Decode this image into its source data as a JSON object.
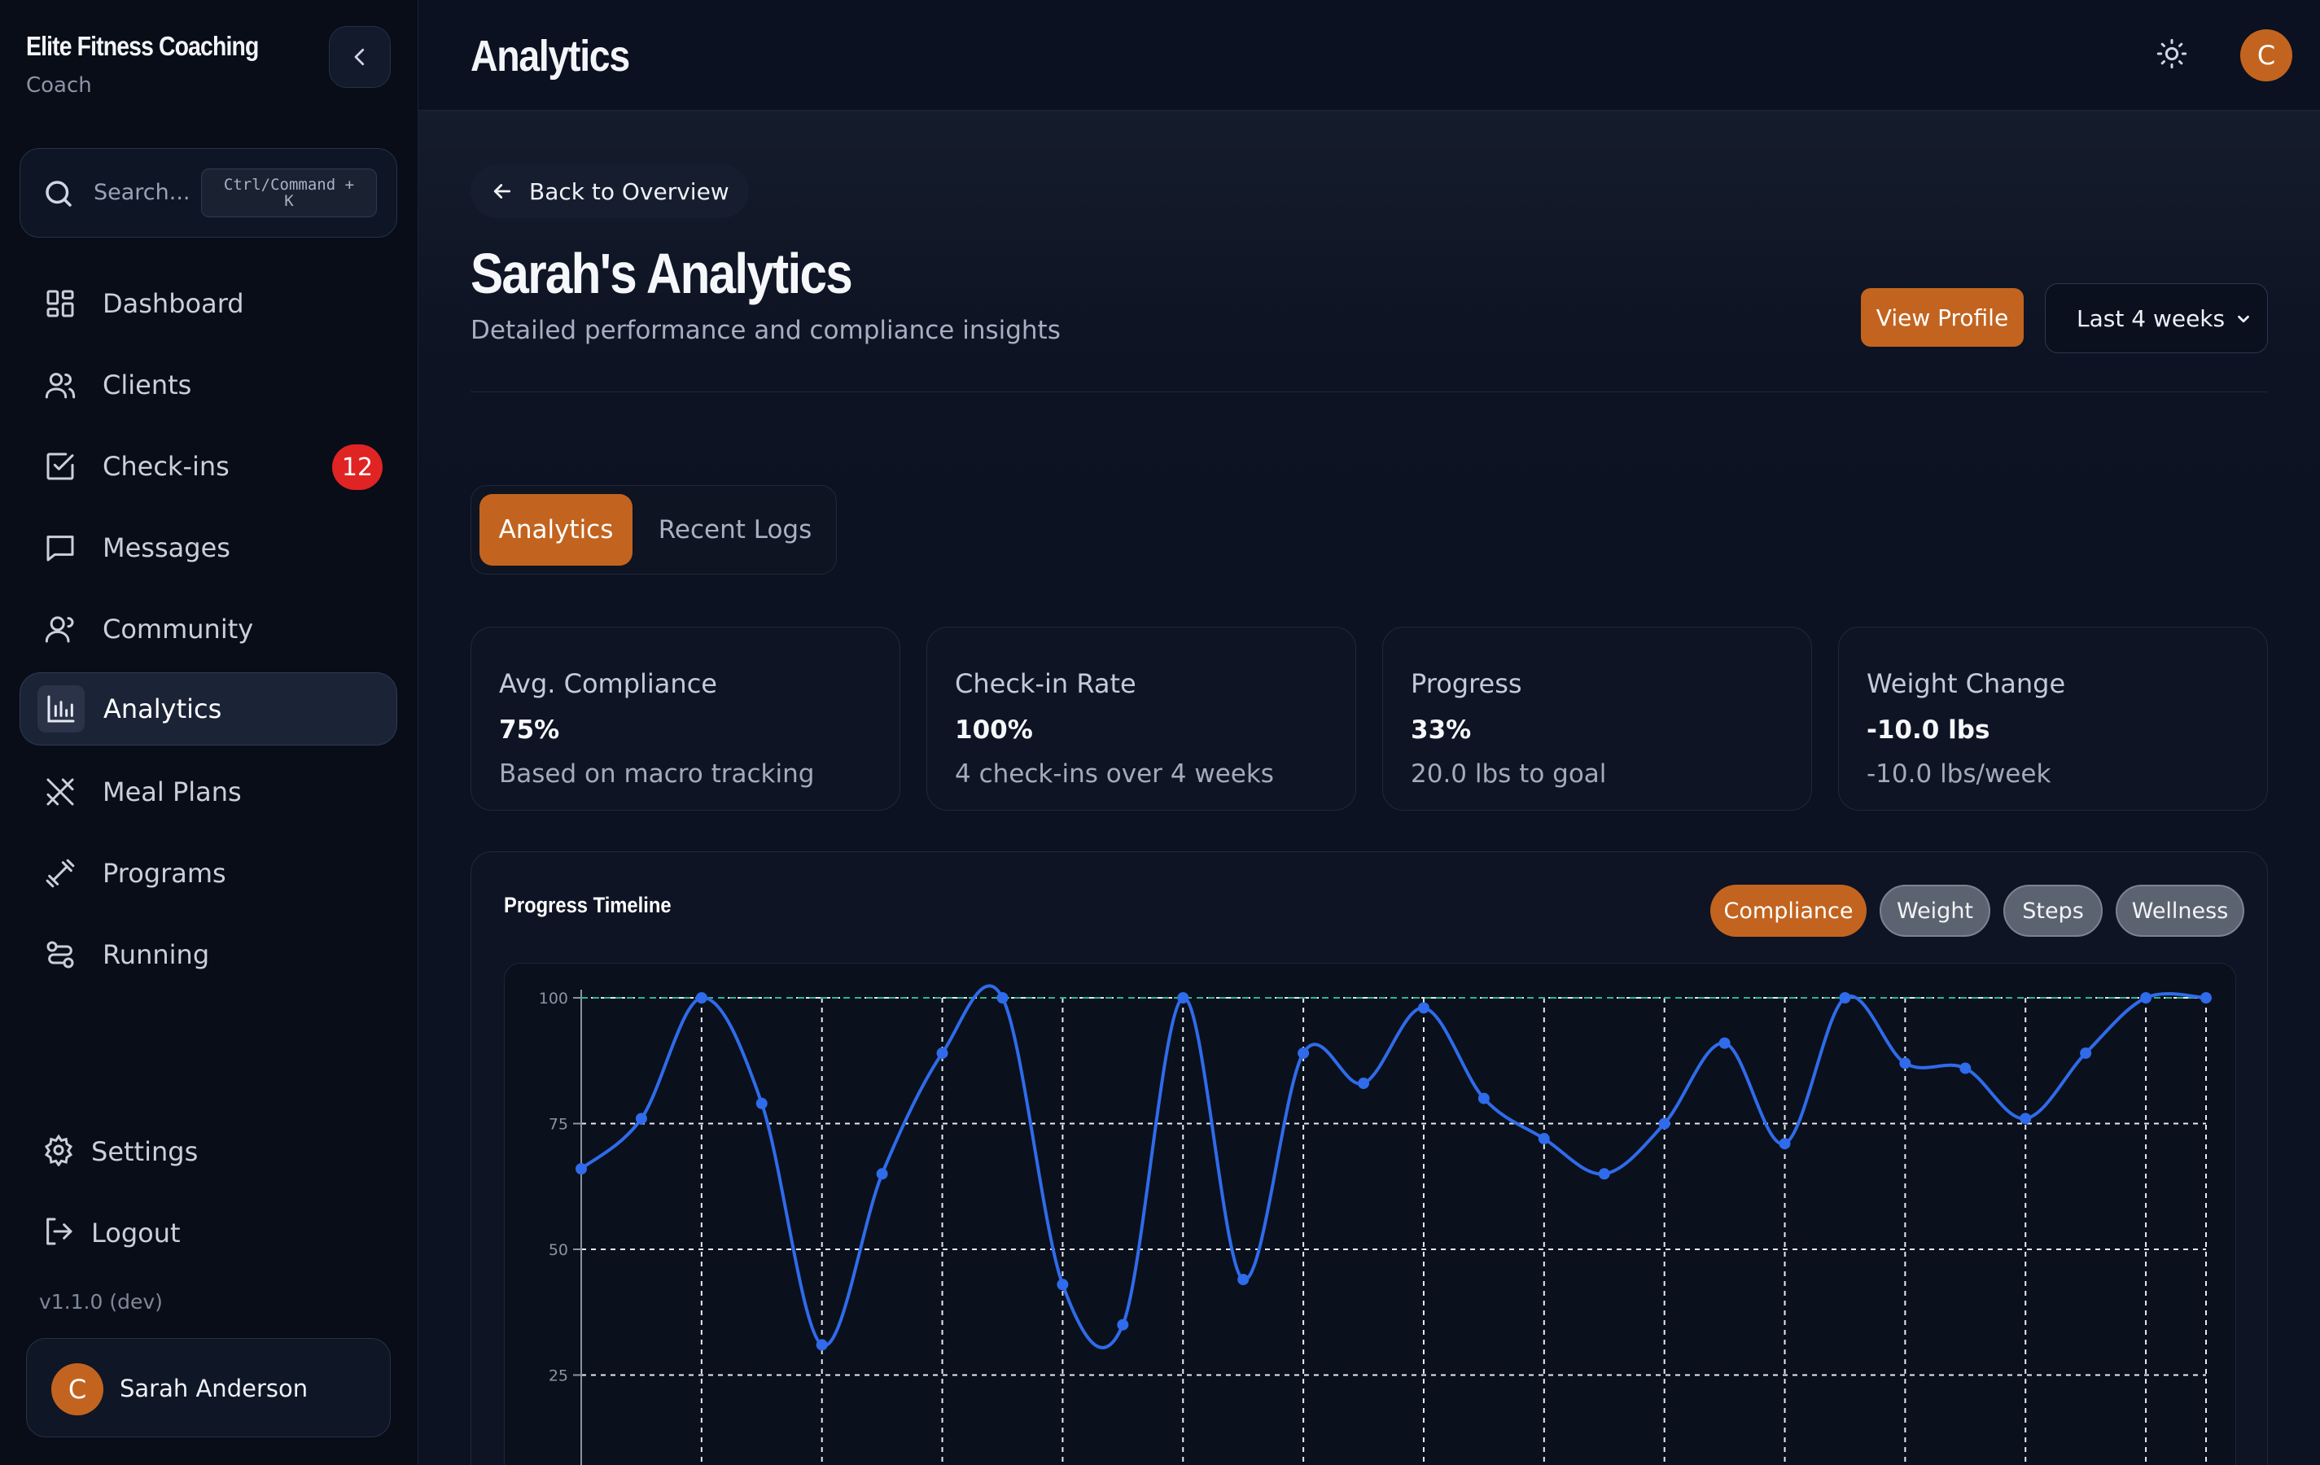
{
  "brand": {
    "title": "Elite Fitness Coaching",
    "role": "Coach"
  },
  "search": {
    "placeholder": "Search...",
    "shortcut_line1": "Ctrl/Command +",
    "shortcut_line2": "K"
  },
  "nav": [
    {
      "label": "Dashboard",
      "icon": "dashboard-icon"
    },
    {
      "label": "Clients",
      "icon": "users-icon"
    },
    {
      "label": "Check-ins",
      "icon": "checkbox-icon",
      "badge": "12"
    },
    {
      "label": "Messages",
      "icon": "message-icon"
    },
    {
      "label": "Community",
      "icon": "community-icon"
    },
    {
      "label": "Analytics",
      "icon": "bar-chart-icon",
      "active": true
    },
    {
      "label": "Meal Plans",
      "icon": "utensils-icon"
    },
    {
      "label": "Programs",
      "icon": "dumbbell-icon"
    },
    {
      "label": "Running",
      "icon": "route-icon"
    }
  ],
  "footer_nav": {
    "settings": "Settings",
    "logout": "Logout",
    "version": "v1.1.0 (dev)"
  },
  "user": {
    "initial": "C",
    "name": "Sarah Anderson"
  },
  "topbar": {
    "title": "Analytics",
    "avatar_initial": "C"
  },
  "page": {
    "back_label": "Back to Overview",
    "heading": "Sarah's Analytics",
    "subtitle": "Detailed performance and compliance insights",
    "view_profile": "View Profile",
    "period": "Last 4 weeks"
  },
  "tabs": {
    "active": "Analytics",
    "inactive": "Recent Logs"
  },
  "stats": [
    {
      "title": "Avg. Compliance",
      "value": "75%",
      "desc": "Based on macro tracking"
    },
    {
      "title": "Check-in Rate",
      "value": "100%",
      "desc": "4 check-ins over 4 weeks"
    },
    {
      "title": "Progress",
      "value": "33%",
      "desc": "20.0 lbs to goal"
    },
    {
      "title": "Weight Change",
      "value": "-10.0 lbs",
      "desc": "-10.0 lbs/week"
    }
  ],
  "chart_section": {
    "title": "Progress Timeline",
    "chips": [
      "Compliance",
      "Weight",
      "Steps",
      "Wellness"
    ]
  },
  "colors": {
    "accent": "#c2641f",
    "line": "#2f6bea",
    "badge": "#e02424",
    "background": "#0c1221"
  },
  "chart_data": {
    "type": "line",
    "yticks": [
      100,
      75,
      50,
      25
    ],
    "ylim": [
      0,
      100
    ],
    "grid": true,
    "series": [
      {
        "values": [
          66,
          76,
          100,
          79,
          31,
          65,
          89,
          100,
          43,
          35,
          100,
          44,
          89,
          83,
          98,
          80,
          72,
          65,
          75,
          91,
          71,
          100,
          87,
          86,
          76,
          89,
          100,
          100
        ]
      }
    ],
    "target": 100
  }
}
